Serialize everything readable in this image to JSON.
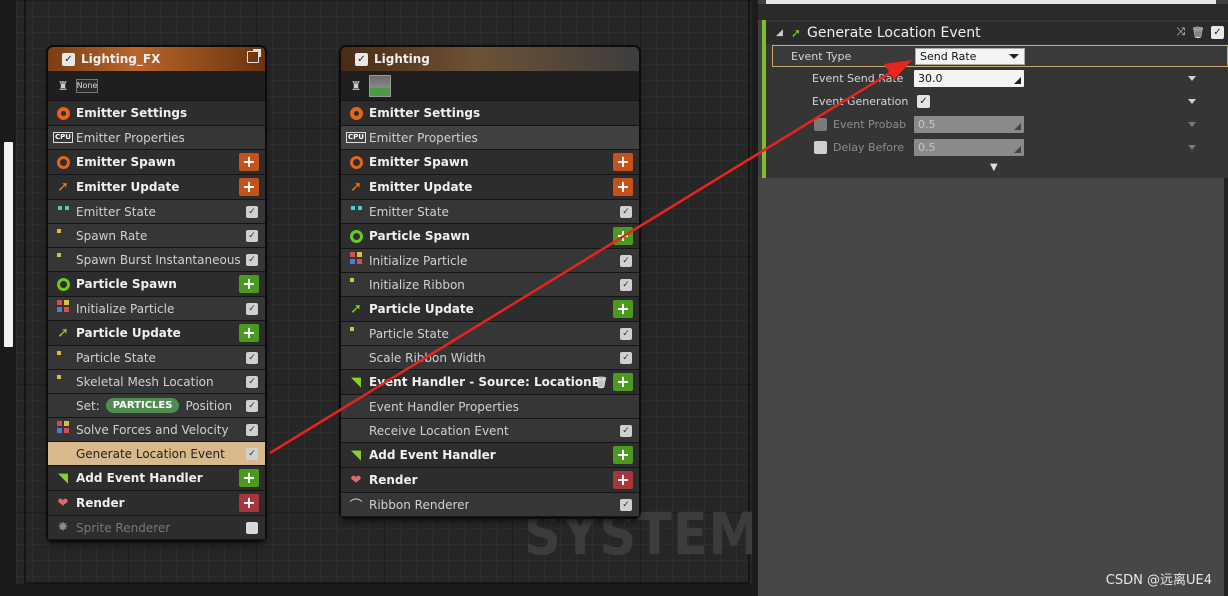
{
  "graph": {
    "watermark": "SYSTEM"
  },
  "nodes": {
    "lighting_fx": {
      "title": "Lighting_FX",
      "thumb_label": "None",
      "rows": [
        {
          "label": "Emitter Settings",
          "kind": "sec",
          "icon": "emitter-settings-icon"
        },
        {
          "label": "Emitter Properties",
          "kind": "sub",
          "icon": "cpu-icon"
        },
        {
          "label": "Emitter Spawn",
          "kind": "sec",
          "icon": "spawn-ring-icon",
          "add": "orange"
        },
        {
          "label": "Emitter Update",
          "kind": "sec",
          "icon": "update-arrow-icon",
          "add": "orange"
        },
        {
          "label": "Emitter State",
          "kind": "sub",
          "icon": "cyan-dots-icon",
          "check": true
        },
        {
          "label": "Spawn Rate",
          "kind": "sub",
          "icon": "yellow-dot-icon",
          "check": true
        },
        {
          "label": "Spawn Burst Instantaneous",
          "kind": "sub",
          "icon": "yellow-dot-icon",
          "check": true
        },
        {
          "label": "Particle Spawn",
          "kind": "sec",
          "icon": "particle-spawn-icon",
          "add": "green"
        },
        {
          "label": "Initialize Particle",
          "kind": "sub",
          "icon": "multi-dot-icon",
          "check": true
        },
        {
          "label": "Particle Update",
          "kind": "sec",
          "icon": "particle-update-icon",
          "add": "green"
        },
        {
          "label": "Particle State",
          "kind": "sub",
          "icon": "yellow-dot-icon",
          "check": true
        },
        {
          "label": "Skeletal Mesh Location",
          "kind": "sub",
          "icon": "yellow-dot-icon",
          "check": true
        },
        {
          "label": "Position",
          "kind": "sub",
          "icon": "none",
          "check": true,
          "prefix": "Set:",
          "pill": "PARTICLES"
        },
        {
          "label": "Solve Forces and Velocity",
          "kind": "sub",
          "icon": "multi-dot-icon",
          "check": true
        },
        {
          "label": "Generate Location Event",
          "kind": "selected",
          "icon": "none",
          "check": true
        },
        {
          "label": "Add Event Handler",
          "kind": "sec",
          "icon": "event-handler-icon",
          "add": "green"
        },
        {
          "label": "Render",
          "kind": "sec",
          "icon": "render-icon",
          "add": "red"
        },
        {
          "label": "Sprite Renderer",
          "kind": "dim",
          "icon": "sprite-icon",
          "check": "empty"
        }
      ]
    },
    "lighting": {
      "title": "Lighting",
      "rows": [
        {
          "label": "Emitter Settings",
          "kind": "sec",
          "icon": "emitter-settings-icon"
        },
        {
          "label": "Emitter Properties",
          "kind": "light",
          "icon": "cpu-icon"
        },
        {
          "label": "Emitter Spawn",
          "kind": "sec",
          "icon": "spawn-ring-icon",
          "add": "orange"
        },
        {
          "label": "Emitter Update",
          "kind": "sec",
          "icon": "update-arrow-icon",
          "add": "orange"
        },
        {
          "label": "Emitter State",
          "kind": "sub",
          "icon": "cyan-dots-icon",
          "check": true
        },
        {
          "label": "Particle Spawn",
          "kind": "sec",
          "icon": "particle-spawn-icon",
          "add": "green"
        },
        {
          "label": "Initialize Particle",
          "kind": "sub",
          "icon": "multi-dot-icon",
          "check": true
        },
        {
          "label": "Initialize Ribbon",
          "kind": "sub",
          "icon": "yellow-dot-icon",
          "check": true
        },
        {
          "label": "Particle Update",
          "kind": "sec",
          "icon": "particle-update-icon",
          "add": "green"
        },
        {
          "label": "Particle State",
          "kind": "sub",
          "icon": "yellow-dot-icon",
          "check": true
        },
        {
          "label": "Scale Ribbon Width",
          "kind": "sub",
          "icon": "none",
          "check": true
        },
        {
          "label": "Event Handler - Source: LocationEvent",
          "kind": "sec",
          "icon": "event-handler-icon",
          "add": "green",
          "trash": true
        },
        {
          "label": "Event Handler Properties",
          "kind": "sub",
          "icon": "none"
        },
        {
          "label": "Receive Location Event",
          "kind": "sub",
          "icon": "none",
          "check": true
        },
        {
          "label": "Add Event Handler",
          "kind": "sec",
          "icon": "event-handler-icon",
          "add": "green"
        },
        {
          "label": "Render",
          "kind": "sec",
          "icon": "render-icon",
          "add": "red"
        },
        {
          "label": "Ribbon Renderer",
          "kind": "sub",
          "icon": "ribbon-icon",
          "check": true
        }
      ]
    }
  },
  "details": {
    "title": "Generate Location Event",
    "event_type_label": "Event Type",
    "event_type_value": "Send Rate",
    "send_rate_label": "Event Send Rate",
    "send_rate_value": "30.0",
    "gen_bias_label": "Event Generation Bias",
    "prob_label": "Event Probability",
    "prob_value": "0.5",
    "delay_label": "Delay Before Send",
    "delay_value": "0.5"
  },
  "credit": "CSDN @远离UE4",
  "colors": {
    "accent_green": "#7bbf2a",
    "selected_row": "#d7b98c",
    "arrow_red": "#e8241c",
    "add_orange": "#c5521b",
    "add_green": "#4a9a1f",
    "add_red": "#a8353b"
  }
}
